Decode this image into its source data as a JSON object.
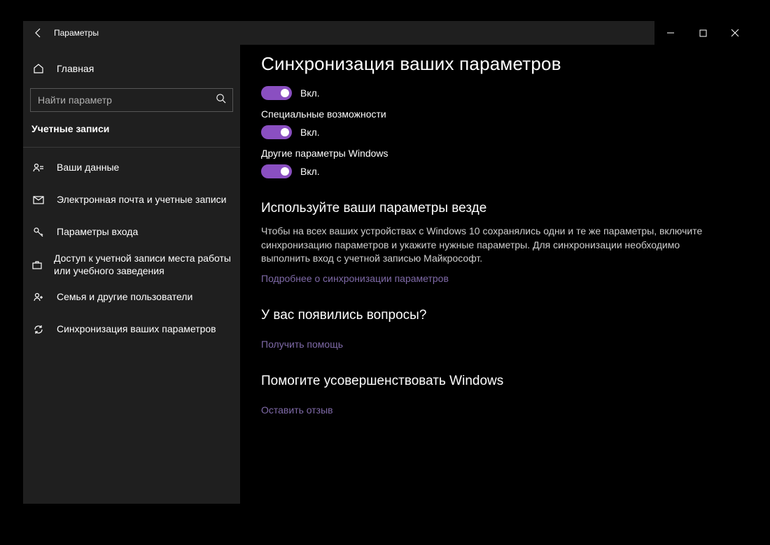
{
  "window": {
    "title": "Параметры"
  },
  "sidebar": {
    "home": "Главная",
    "search_placeholder": "Найти параметр",
    "section": "Учетные записи",
    "items": [
      {
        "label": "Ваши данные"
      },
      {
        "label": "Электронная почта и учетные записи"
      },
      {
        "label": "Параметры входа"
      },
      {
        "label": "Доступ к учетной записи места работы или учебного заведения"
      },
      {
        "label": "Семья и другие пользователи"
      },
      {
        "label": "Синхронизация ваших параметров"
      }
    ]
  },
  "main": {
    "title": "Синхронизация ваших параметров",
    "toggles": [
      {
        "label": "",
        "state": "Вкл."
      },
      {
        "label": "Специальные возможности",
        "state": "Вкл."
      },
      {
        "label": "Другие параметры Windows",
        "state": "Вкл."
      }
    ],
    "use_everywhere": {
      "heading": "Используйте ваши параметры везде",
      "text": "Чтобы на всех ваших устройствах с Windows 10 сохранялись одни и те же параметры, включите синхронизацию параметров и укажите нужные параметры. Для синхронизации необходимо выполнить вход с учетной записью Майкрософт.",
      "link": "Подробнее о синхронизации параметров"
    },
    "questions": {
      "heading": "У вас появились вопросы?",
      "link": "Получить помощь"
    },
    "feedback": {
      "heading": "Помогите усовершенствовать Windows",
      "link": "Оставить отзыв"
    }
  }
}
